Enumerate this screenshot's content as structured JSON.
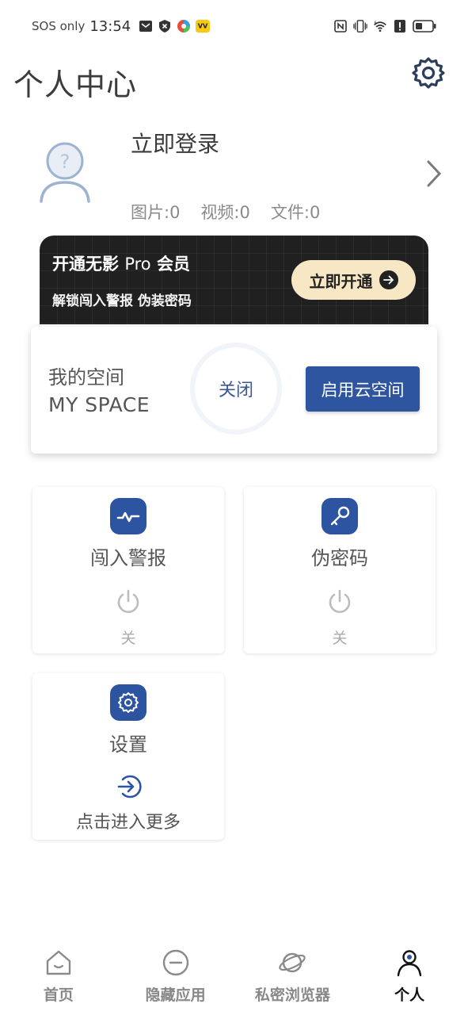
{
  "status_bar": {
    "carrier": "SOS only",
    "time": "13:54",
    "icons": [
      "mail-icon",
      "shield-x-icon",
      "colorful-app-icon",
      "yellow-app-icon",
      "nfc-icon",
      "vibrate-icon",
      "wifi-6-icon",
      "alert-icon",
      "battery-icon"
    ]
  },
  "header": {
    "title": "个人中心",
    "settings_icon": "gear-icon"
  },
  "profile": {
    "login_label": "立即登录",
    "stats": [
      {
        "label": "图片:0"
      },
      {
        "label": "视频:0"
      },
      {
        "label": "文件:0"
      }
    ]
  },
  "pro_banner": {
    "title_prefix": "开通无影",
    "title_pro": "Pro",
    "title_suffix": "会员",
    "subtitle": "解锁闯入警报 伪装密码",
    "button_label": "立即开通"
  },
  "space": {
    "title": "我的空间",
    "subtitle": "MY SPACE",
    "toggle_label": "关闭",
    "cloud_button": "启用云空间"
  },
  "tiles": {
    "intrusion": {
      "label": "闯入警报",
      "state": "关"
    },
    "fake_password": {
      "label": "伪密码",
      "state": "关"
    },
    "settings": {
      "label": "设置",
      "more_label": "点击进入更多"
    }
  },
  "bottom_nav": {
    "items": [
      {
        "label": "首页",
        "icon": "home-icon"
      },
      {
        "label": "隐藏应用",
        "icon": "minus-circle-icon"
      },
      {
        "label": "私密浏览器",
        "icon": "planet-icon"
      },
      {
        "label": "个人",
        "icon": "person-icon",
        "active": true
      }
    ]
  },
  "colors": {
    "accent": "#2d55a0",
    "pro_gold": "#f8e7c4",
    "banner_dark": "#202020"
  }
}
